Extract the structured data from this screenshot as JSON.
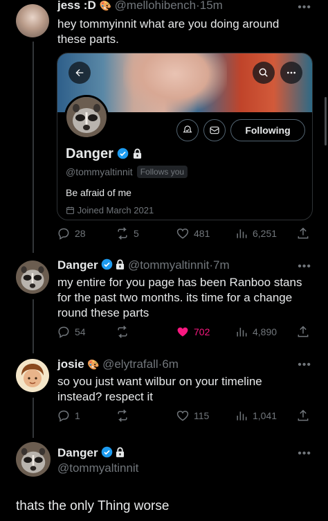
{
  "posts": [
    {
      "name": "jess :D",
      "handle": "@mellohibench",
      "time": "15m",
      "text_line1": "hey tommyinnit what are you doing around",
      "text_line2": "these parts.",
      "quoted_profile": {
        "display_name": "Danger",
        "handle": "@tommyaltinnit",
        "follows_you": "Follows you",
        "bio": "Be afraid of me",
        "joined": "Joined March 2021",
        "follow_button": "Following"
      },
      "replies": "28",
      "reposts": "5",
      "likes": "481",
      "views": "6,251"
    },
    {
      "name": "Danger",
      "handle": "@tommyaltinnit",
      "time": "7m",
      "text_line1": "my entire for you page has been Ranboo stans",
      "text_line2": "for the past two months. its time for a change",
      "text_line3": "round these parts",
      "replies": "54",
      "reposts": "",
      "likes": "702",
      "views": "4,890",
      "liked_color": "#f91880"
    },
    {
      "name": "josie",
      "handle": "@elytrafall",
      "time": "6m",
      "text_line1": "so you just want wilbur on your timeline",
      "text_line2": "instead? respect it",
      "replies": "1",
      "reposts": "",
      "likes": "115",
      "views": "1,041"
    },
    {
      "name": "Danger",
      "handle": "@tommyaltinnit",
      "text": "thats the only Thing worse"
    }
  ],
  "separator": "·",
  "colors": {
    "background": "#000000",
    "muted": "#71767b",
    "verified": "#1d9bf0",
    "like": "#f91880"
  }
}
